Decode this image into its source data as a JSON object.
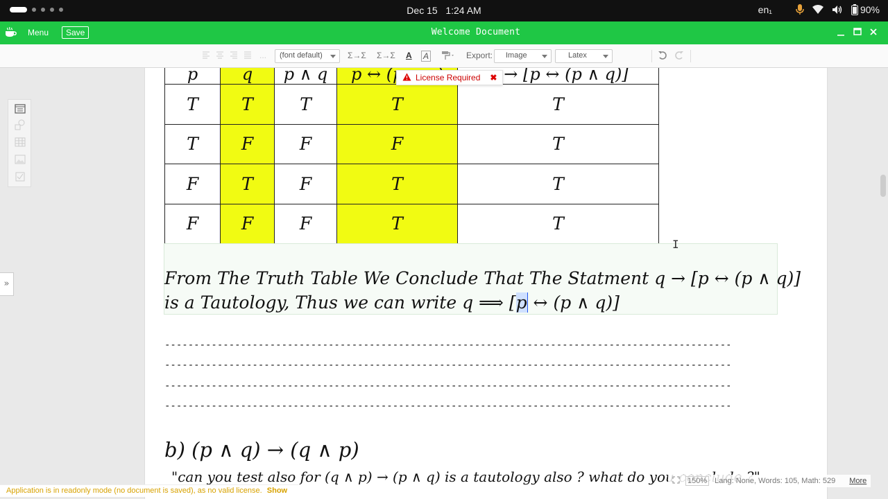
{
  "system_bar": {
    "date": "Dec 15",
    "time": "1:24 AM",
    "keyboard_layout": "en₁",
    "battery": "90%"
  },
  "titlebar": {
    "menu_label": "Menu",
    "save_label": "Save",
    "window_title": "Welcome Document"
  },
  "toolbar": {
    "font_select": "(font default)",
    "export_label": "Export:",
    "export_format": "Image",
    "export_mode": "Latex",
    "sigma_left_label": "Σ→Σ",
    "sigma_right_label": "Σ→Σ",
    "text_color_label": "A",
    "text_highlight_label": "A",
    "ellipsis_label": "..."
  },
  "truth_table": {
    "header": [
      "p",
      "q",
      "p ∧ q",
      "p ↔ (p ∧ q)",
      "q → [p ↔ (p ∧ q)]"
    ],
    "rows": [
      [
        "T",
        "T",
        "T",
        "T",
        "T"
      ],
      [
        "T",
        "F",
        "F",
        "F",
        "T"
      ],
      [
        "F",
        "T",
        "F",
        "T",
        "T"
      ],
      [
        "F",
        "F",
        "F",
        "T",
        "T"
      ]
    ],
    "highlight_color": "#f1fb12"
  },
  "license_popup": {
    "text": "License Required"
  },
  "conclusion": {
    "line1": "From The Truth Table We Conclude That The Statment q → [p ↔ (p ∧ q)]",
    "line2_pre": "is a Tautology,  Thus we can write q  ⟹ [",
    "line2_cursor": "p",
    "line2_post": " ↔ (p ∧ q)]"
  },
  "divider_text": "------------------------------------------------------------------------------------------------------------------------------------------------------------",
  "part_b": {
    "heading": "b) (p ∧ q) → (q ∧ p)",
    "question": "\"can you test also for  (q ∧ p) → (p ∧ q) is a tautology also ?  what do you conclude ?\""
  },
  "status": {
    "readonly_message": "Application is in readonly mode (no document is saved), as no valid license.",
    "show_label": "Show",
    "zoom": "150%",
    "stats": "Lang: None, Words: 105, Math: 529",
    "more_label": "More"
  },
  "colors": {
    "title_green": "#1fc745",
    "cell_yellow": "#f1fb12",
    "readonly_text": "#d8a200",
    "license_red": "#cc0000"
  }
}
